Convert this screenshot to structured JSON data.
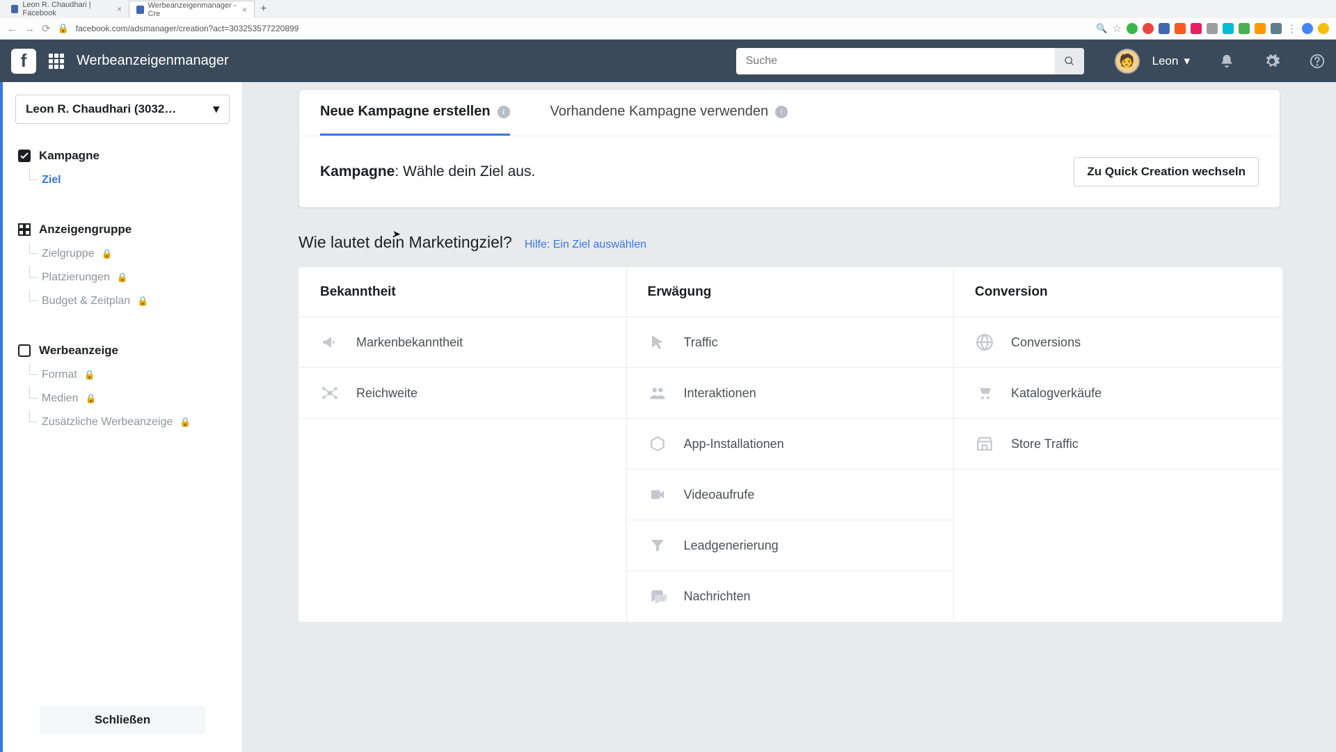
{
  "browser": {
    "tabs": [
      {
        "title": "Leon R. Chaudhari | Facebook"
      },
      {
        "title": "Werbeanzeigenmanager - Cre"
      }
    ],
    "url": "facebook.com/adsmanager/creation?act=303253577220899"
  },
  "topbar": {
    "app_title": "Werbeanzeigenmanager",
    "search_placeholder": "Suche",
    "user_name": "Leon"
  },
  "sidebar": {
    "account_label": "Leon R. Chaudhari (3032…",
    "sections": {
      "campaign": {
        "title": "Kampagne",
        "items": [
          "Ziel"
        ]
      },
      "adset": {
        "title": "Anzeigengruppe",
        "items": [
          "Zielgruppe",
          "Platzierungen",
          "Budget & Zeitplan"
        ]
      },
      "ad": {
        "title": "Werbeanzeige",
        "items": [
          "Format",
          "Medien",
          "Zusätzliche Werbeanzeige"
        ]
      }
    },
    "close_label": "Schließen"
  },
  "card": {
    "tab_new": "Neue Kampagne erstellen",
    "tab_existing": "Vorhandene Kampagne verwenden",
    "campaign_label": "Kampagne",
    "campaign_sub": ": Wähle dein Ziel aus.",
    "quick_btn": "Zu Quick Creation wechseln"
  },
  "goals": {
    "title": "Wie lautet dein Marketingziel?",
    "help": "Hilfe: Ein Ziel auswählen",
    "cols": {
      "awareness": "Bekanntheit",
      "consideration": "Erwägung",
      "conversion": "Conversion"
    },
    "awareness": [
      "Markenbekanntheit",
      "Reichweite"
    ],
    "consideration": [
      "Traffic",
      "Interaktionen",
      "App-Installationen",
      "Videoaufrufe",
      "Leadgenerierung",
      "Nachrichten"
    ],
    "conversion": [
      "Conversions",
      "Katalogverkäufe",
      "Store Traffic"
    ]
  }
}
